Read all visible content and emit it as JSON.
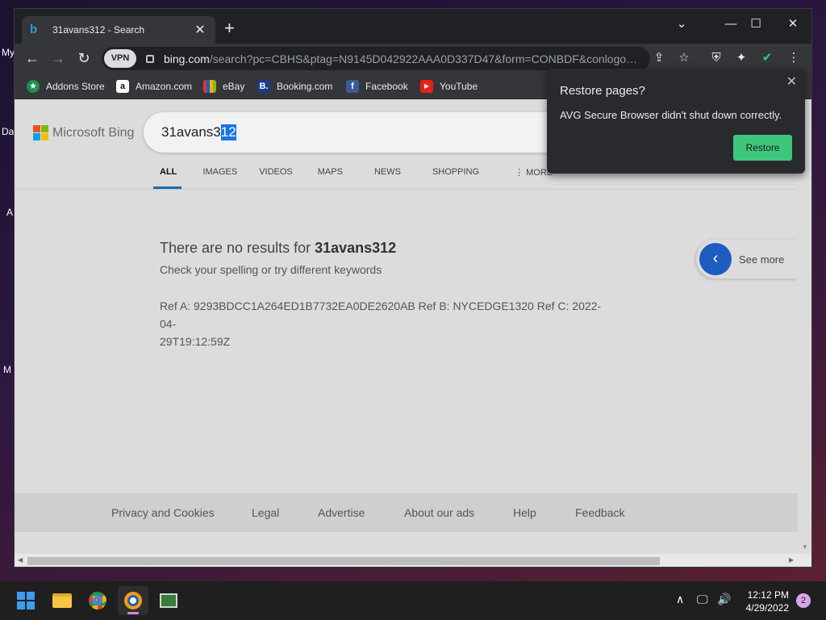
{
  "desktop": {
    "labels": [
      "My",
      "Da",
      "A",
      "M"
    ]
  },
  "tab": {
    "title": "31avans312 - Search",
    "favicon": "bing-icon"
  },
  "window_controls": {
    "dropdown": "⌄",
    "minimize": "—",
    "maximize": "☐",
    "close": "✕"
  },
  "toolbar": {
    "vpn_label": "VPN",
    "url_host": "bing.com",
    "url_path": "/search?pc=CBHS&ptag=N9145D042922AAA0D337D47&form=CONBDF&conlogo=..."
  },
  "bookmarks": [
    {
      "label": "Addons Store",
      "icon": "addons-store-icon",
      "color": "#1e8f4e",
      "glyph": "★"
    },
    {
      "label": "Amazon.com",
      "icon": "amazon-icon",
      "color": "#ffffff",
      "glyph": "a"
    },
    {
      "label": "eBay",
      "icon": "ebay-icon",
      "color": "#e53238",
      "glyph": "▬"
    },
    {
      "label": "Booking.com",
      "icon": "booking-icon",
      "color": "#1b3a87",
      "glyph": "B."
    },
    {
      "label": "Facebook",
      "icon": "facebook-icon",
      "color": "#3b5998",
      "glyph": "f"
    },
    {
      "label": "YouTube",
      "icon": "youtube-icon",
      "color": "#e62117",
      "glyph": "▶"
    }
  ],
  "bing": {
    "logo_text": "Microsoft Bing",
    "query_plain": "31avans3",
    "query_selected": "12",
    "scopes": [
      "ALL",
      "IMAGES",
      "VIDEOS",
      "MAPS",
      "NEWS",
      "SHOPPING",
      "MORE"
    ],
    "no_results_prefix": "There are no results for ",
    "no_results_query": "31avans312",
    "hint": "Check your spelling or try different keywords",
    "refs_line1": "Ref A: 9293BDCC1A264ED1B7732EA0DE2620AB Ref B: NYCEDGE1320 Ref C: 2022-04-",
    "refs_line2": "29T19:12:59Z",
    "see_more": "See more",
    "footer": [
      "Privacy and Cookies",
      "Legal",
      "Advertise",
      "About our ads",
      "Help",
      "Feedback"
    ]
  },
  "popup": {
    "title": "Restore pages?",
    "message": "AVG Secure Browser didn't shut down correctly.",
    "button": "Restore"
  },
  "taskbar": {
    "time": "12:12 PM",
    "date": "4/29/2022",
    "notification_count": "2"
  },
  "colors": {
    "restore_button": "#3ec77c",
    "bing_accent": "#1a6ea8",
    "selection": "#1a73e8"
  }
}
